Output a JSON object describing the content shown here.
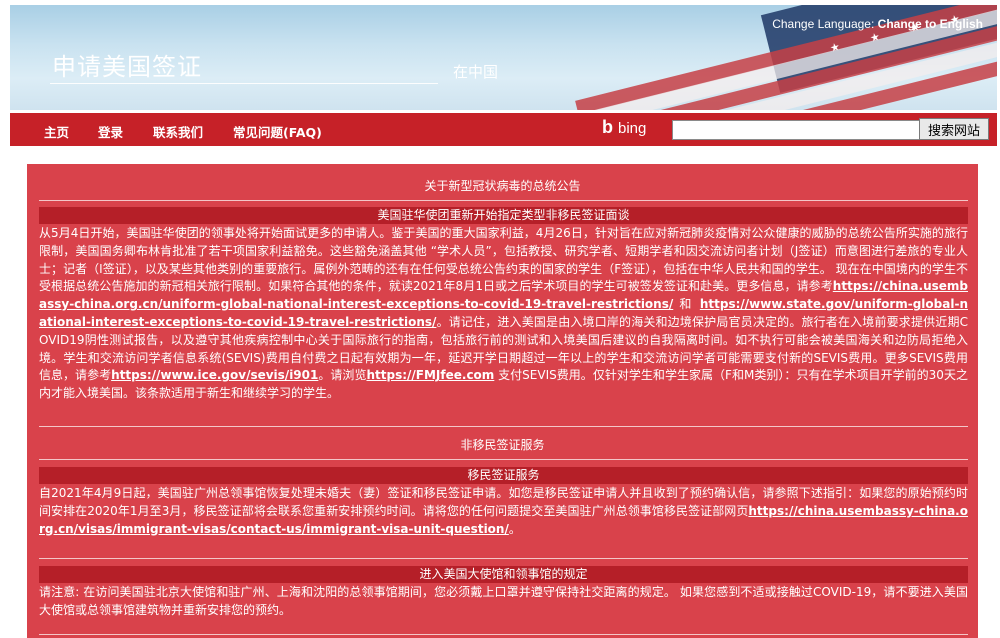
{
  "header": {
    "title": "申请美国签证",
    "subtitle": "在中国",
    "change_language_label": "Change Language:",
    "change_language_link": "Change to English"
  },
  "nav": {
    "items": [
      "主页",
      "登录",
      "联系我们",
      "常见问题(FAQ)"
    ],
    "bing_text": "bing",
    "search_placeholder": "",
    "search_button": "搜索网站"
  },
  "notice": {
    "title": "关于新型冠状病毒的总统公告",
    "subheading": "美国驻华使团重新开始指定类型非移民签证面谈",
    "p1": "从5月4日开始，美国驻华使团的领事处将开始面试更多的申请人。鉴于美国的重大国家利益，4月26日，针对旨在应对新冠肺炎疫情对公众健康的威胁的总统公告所实施的旅行限制，美国国务卿布林肯批准了若干项国家利益豁免。这些豁免涵盖其他 “学术人员”，包括教授、研究学者、短期学者和因交流访问者计划（J签证）而意图进行差旅的专业人士；记者（I签证），以及某些其他类别的重要旅行。属例外范畴的还有在任何受总统公告约束的国家的学生（F签证），包括在中华人民共和国的学生。 现在在中国境内的学生不受根据总统公告施加的新冠相关旅行限制。如果符合其他的条件，就读2021年8月1日或之后学术项目的学生可被签发签证和赴美。更多信息，请参考",
    "link1": "https://china.usembassy-china.org.cn/uniform-global-national-interest-exceptions-to-covid-19-travel-restrictions/",
    "and_text": " 和 ",
    "link2": "https://www.state.gov/uniform-global-national-interest-exceptions-to-covid-19-travel-restrictions/",
    "p2": "。请记住，进入美国是由入境口岸的海关和边境保护局官员决定的。旅行者在入境前要求提供近期COVID19阴性测试报告，以及遵守其他疾病控制中心关于国际旅行的指南，包括旅行前的测试和入境美国后建议的自我隔离时间。如不执行可能会被美国海关和边防局拒绝入境。学生和交流访问学者信息系统(SEVIS)费用自付费之日起有效期为一年，延迟开学日期超过一年以上的学生和交流访问学者可能需要支付新的SEVIS费用。更多SEVIS费用信息，请参考",
    "link3": "https://www.ice.gov/sevis/i901",
    "p3": "。请浏览",
    "link4": "https://FMJfee.com",
    "p4": " 支付SEVIS费用。仅针对学生和学生家属（F和M类别）：只有在学术项目开学前的30天之内才能入境美国。该条款适用于新生和继续学习的学生。"
  },
  "nonimmigrant": {
    "title": "非移民签证服务"
  },
  "immigrant": {
    "subheading": "移民签证服务",
    "p1": "自2021年4月9日起，美国驻广州总领事馆恢复处理未婚夫（妻）签证和移民签证申请。如您是移民签证申请人并且收到了预约确认信，请参照下述指引：如果您的原始预约时间安排在2020年1月至3月，移民签证部将会联系您重新安排预约时间。请将您的任何问题提交至美国驻广州总领事馆移民签证部网页",
    "link": "https://china.usembassy-china.org.cn/visas/immigrant-visas/contact-us/immigrant-visa-unit-question/",
    "p2": "。"
  },
  "entry_rules": {
    "subheading": "进入美国大使馆和领事馆的规定",
    "p1": "请注意: 在访问美国驻北京大使馆和驻广州、上海和沈阳的总领事馆期间，您必须戴上口罩并遵守保持社交距离的规定。 如果您感到不适或接触过COVID-19，请不要进入美国大使馆或总领事馆建筑物并重新安排您的预约。"
  },
  "colors": {
    "nav_red": "#c62128",
    "content_red": "#d9424b",
    "subheading_red": "#b51f28"
  }
}
